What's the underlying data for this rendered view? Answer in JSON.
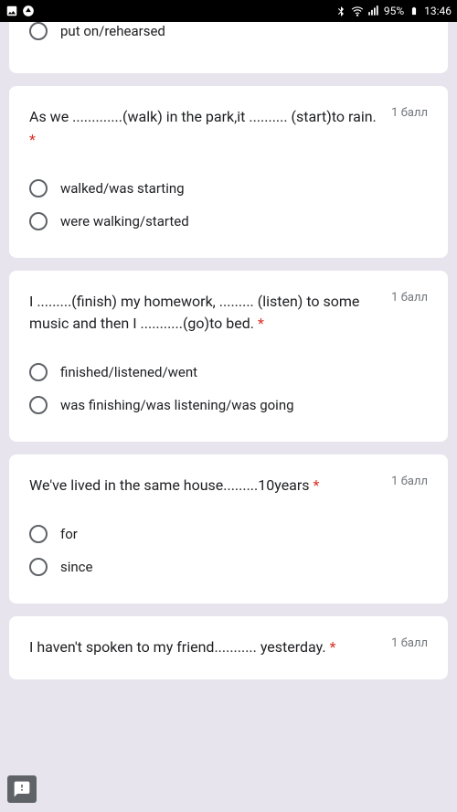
{
  "status_bar": {
    "battery_pct": "95%",
    "time": "13:46"
  },
  "card0": {
    "option0": "put on/rehearsed"
  },
  "q1": {
    "text": "As we .............(walk) in the park,it .......... (start)to rain.",
    "required": "*",
    "points": "1 балл",
    "option0": "walked/was starting",
    "option1": "were walking/started"
  },
  "q2": {
    "text": "I .........(finish) my homework, ......... (listen) to some music and then I ...........(go)to bed.",
    "required": "*",
    "points": "1 балл",
    "option0": "finished/listened/went",
    "option1": "was finishing/was listening/was going"
  },
  "q3": {
    "text": "We've lived in the same house.........10years",
    "required": "*",
    "points": "1 балл",
    "option0": "for",
    "option1": "since"
  },
  "q4": {
    "text": "I haven't spoken to my friend........... yesterday.",
    "required": "*",
    "points": "1 балл"
  }
}
